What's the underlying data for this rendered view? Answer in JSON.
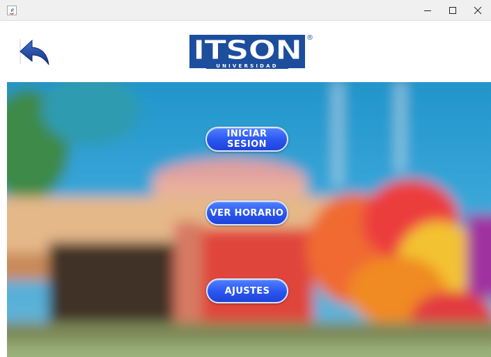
{
  "window": {
    "controls": {
      "minimize_icon": "minimize-icon",
      "maximize_icon": "maximize-icon",
      "close_icon": "close-icon"
    }
  },
  "header": {
    "back_icon": "back-arrow-icon",
    "logo": {
      "text": "ITSON",
      "subtitle": "UNIVERSIDAD",
      "registered_mark": "®"
    }
  },
  "main": {
    "buttons": [
      {
        "label": "INICIAR SESION"
      },
      {
        "label": "VER HORARIO"
      },
      {
        "label": "AJUSTES"
      }
    ]
  },
  "colors": {
    "logo_blue": "#1d4e9e",
    "button_blue": "#2a55f0",
    "back_arrow": "#1f3f8f"
  }
}
